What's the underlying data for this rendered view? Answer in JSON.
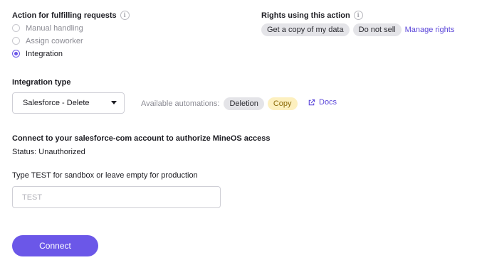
{
  "action_section": {
    "title": "Action for fulfilling requests",
    "info_icon": "info-icon",
    "options": [
      {
        "label": "Manual handling",
        "selected": false
      },
      {
        "label": "Assign coworker",
        "selected": false
      },
      {
        "label": "Integration",
        "selected": true
      }
    ]
  },
  "rights_section": {
    "title": "Rights using this action",
    "info_icon": "info-icon",
    "chips": [
      "Get a copy of my data",
      "Do not sell"
    ],
    "manage_link": "Manage rights"
  },
  "integration": {
    "title": "Integration type",
    "selected_value": "Salesforce - Delete",
    "available_label": "Available automations:",
    "automations": [
      {
        "label": "Deletion",
        "color": "#e4e4e8"
      },
      {
        "label": "Copy",
        "color": "#fdf0bf"
      }
    ],
    "docs_icon": "external-link-icon",
    "docs_link": "Docs"
  },
  "connect_section": {
    "title": "Connect to your salesforce-com account to authorize MineOS access",
    "status": "Status: Unauthorized",
    "sandbox_label": "Type TEST for sandbox or leave empty for production",
    "sandbox_value": "",
    "sandbox_placeholder": "TEST",
    "button_label": "Connect"
  },
  "accent_color": "#6b57e8"
}
